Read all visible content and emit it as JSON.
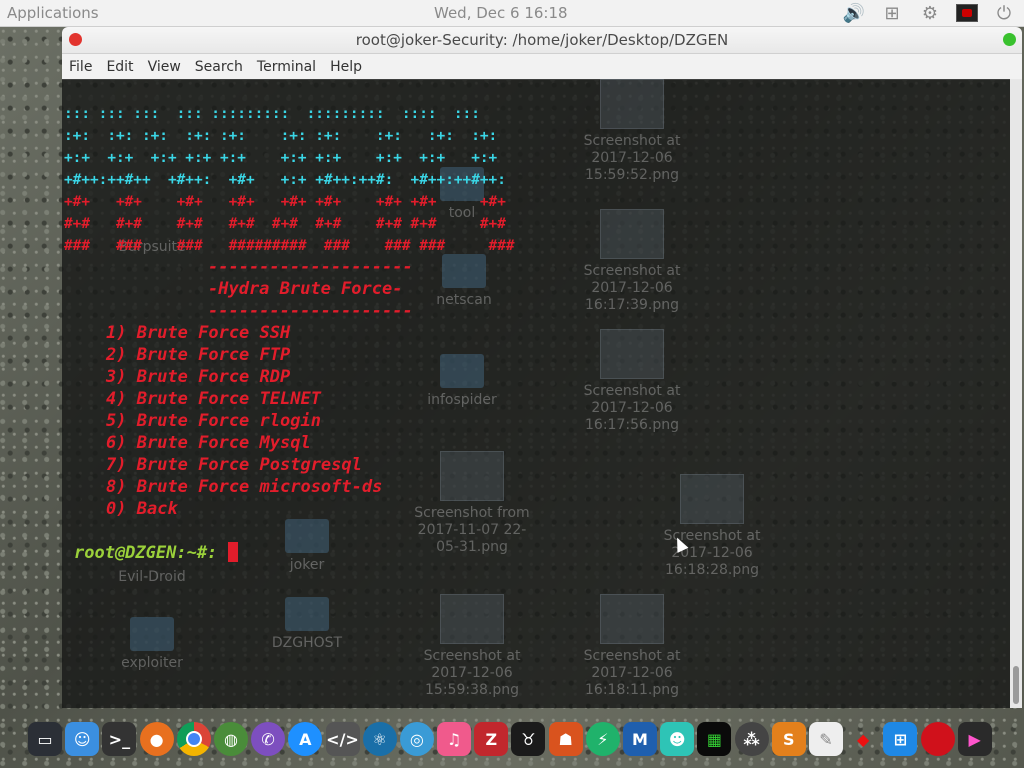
{
  "panel": {
    "apps": "Applications",
    "clock": "Wed, Dec  6  16:18"
  },
  "window": {
    "title": "root@joker-Security: /home/joker/Desktop/DZGEN",
    "menu": [
      "File",
      "Edit",
      "View",
      "Search",
      "Terminal",
      "Help"
    ]
  },
  "terminal": {
    "banner": [
      "::: ::: :::  ::: :::::::::  :::::::::  ::::  :::",
      ":+:  :+: :+:  :+: :+:    :+: :+:    :+:   :+:  :+:",
      "+:+  +:+  +:+ +:+ +:+    +:+ +:+    +:+  +:+   +:+",
      "+#++:++#++  +#++:  +#+   +:+ +#++:++#:  +#++:++#++:",
      "+#+   +#+    +#+   +#+   +#+ +#+    +#+ +#+     +#+",
      "#+#   #+#    #+#   #+#  #+#  #+#    #+# #+#     #+#",
      "###   ###    ###   #########  ###    ### ###     ###"
    ],
    "divider": "--------------------",
    "heading": "-Hydra Brute Force-",
    "options": [
      "1) Brute Force SSH",
      "2) Brute Force FTP",
      "3) Brute Force RDP",
      "4) Brute Force TELNET",
      "5) Brute Force rlogin",
      "6) Brute Force Mysql",
      "7) Brute Force Postgresql",
      "8) Brute Force microsoft-ds",
      "0) Back"
    ],
    "prompt": "root@DZGEN:~#: "
  },
  "desktop_icons": [
    "Screenshot at 2017-12-06 15:59:52.png",
    "tool",
    "Burpsuite",
    "netscan",
    "Screenshot at 2017-12-06 16:17:39.png",
    "infospider",
    "Screenshot at 2017-12-06 16:17:56.png",
    "Screenshot from 2017-11-07 22-05-31.png",
    "Screenshot at 2017-12-06 16:18:28.png",
    "joker",
    "Evil-Droid",
    "DZGHOST",
    "exploiter",
    "Screenshot at 2017-12-06 15:59:38.png",
    "Screenshot at 2017-12-06 16:18:11.png"
  ],
  "dock_apps": [
    "disks",
    "finder",
    "terminal",
    "firefox",
    "chrome",
    "earth",
    "viber",
    "app-store",
    "scripts",
    "atom",
    "browser",
    "music",
    "filezilla",
    "bull",
    "warrior",
    "sync",
    "malwarebytes",
    "anime",
    "matrix",
    "colors",
    "sublime",
    "notes",
    "red-diamond",
    "windows",
    "record",
    "final-cut"
  ],
  "colors": {
    "banner_cyan": "#3ad6e6",
    "banner_red": "#e21d2b",
    "prompt_green": "#9bd13a"
  }
}
